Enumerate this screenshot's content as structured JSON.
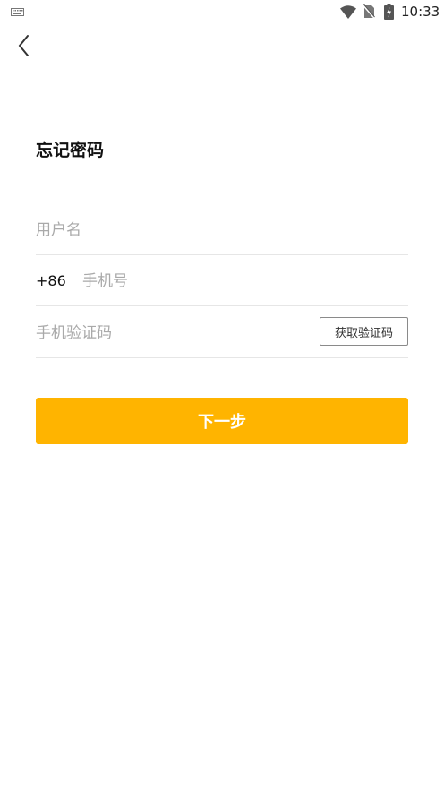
{
  "status_bar": {
    "time": "10:33",
    "icons": [
      "keyboard-icon",
      "wifi-icon",
      "no-sim-icon",
      "battery-charging-icon"
    ]
  },
  "nav": {
    "back_icon": "chevron-left-icon"
  },
  "page": {
    "title": "忘记密码"
  },
  "form": {
    "username": {
      "value": "",
      "placeholder": "用户名"
    },
    "phone": {
      "country_code": "+86",
      "value": "",
      "placeholder": "手机号"
    },
    "code": {
      "value": "",
      "placeholder": "手机验证码",
      "get_code_label": "获取验证码"
    }
  },
  "actions": {
    "next_label": "下一步"
  },
  "colors": {
    "accent": "#ffb400",
    "placeholder": "#a9a9a9",
    "divider": "#e6e6e6"
  }
}
